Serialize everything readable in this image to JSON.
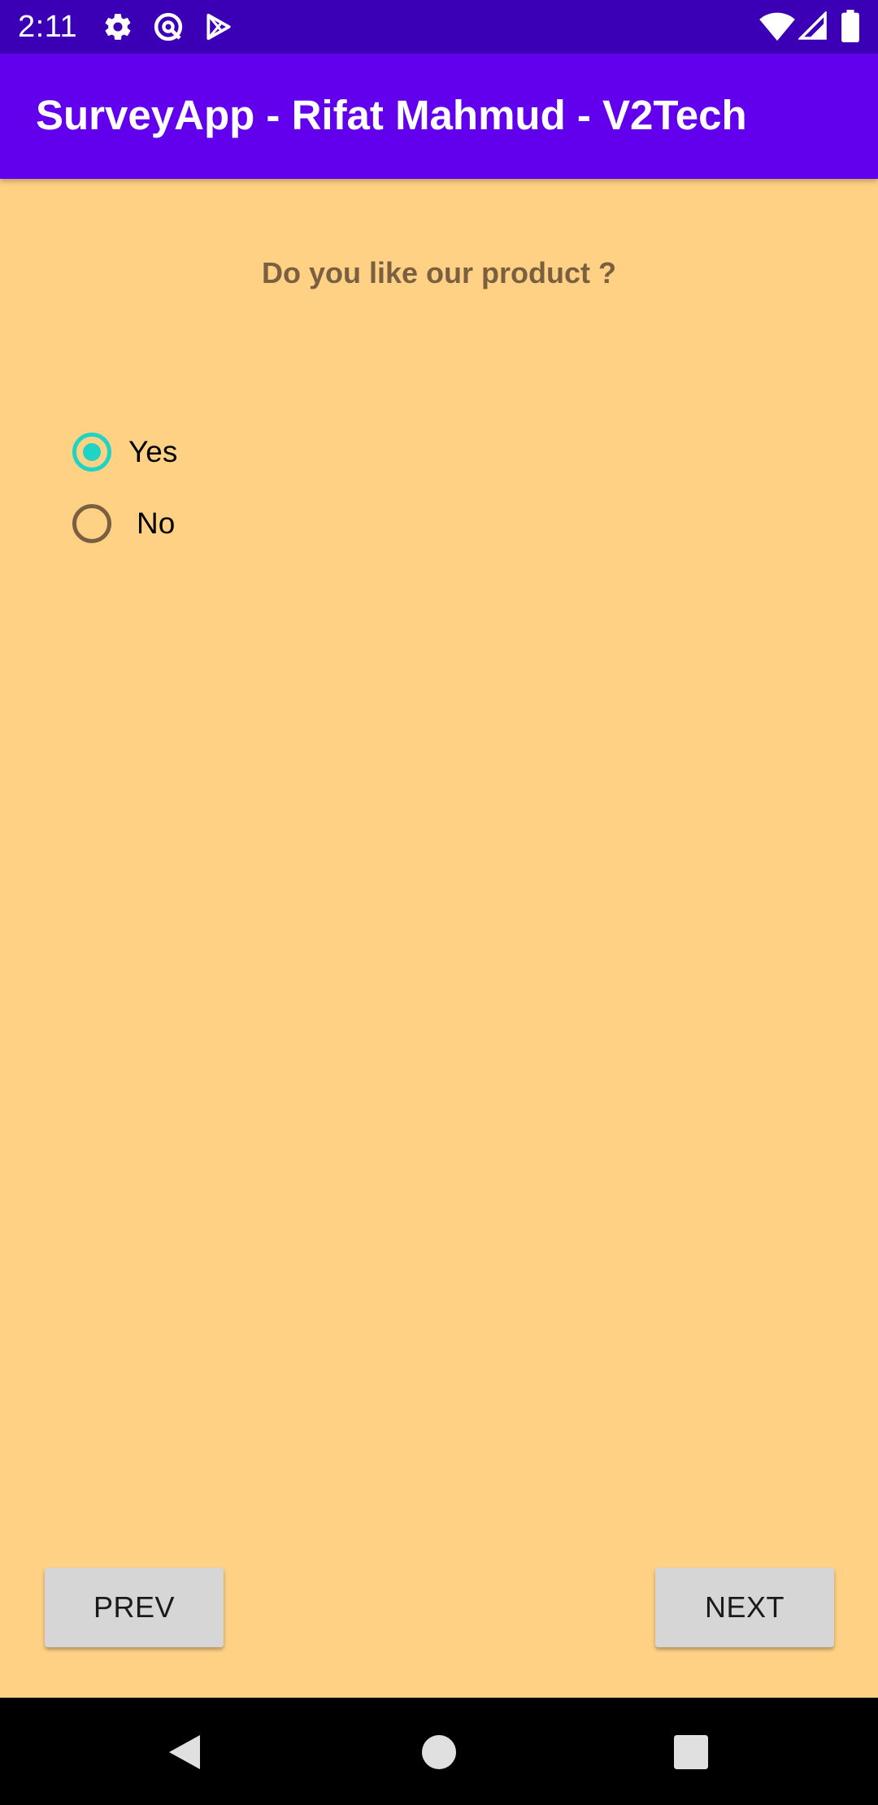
{
  "status_bar": {
    "time": "2:11",
    "left_icons": [
      "gear-icon",
      "data-saver-icon",
      "play-store-icon"
    ],
    "right_icons": [
      "wifi-icon",
      "cell-signal-icon",
      "battery-icon"
    ]
  },
  "app_bar": {
    "title": "SurveyApp - Rifat Mahmud - V2Tech",
    "color": "#6200EE"
  },
  "survey": {
    "question": "Do you like our product ?",
    "options": [
      {
        "label": "Yes",
        "selected": true
      },
      {
        "label": "No",
        "selected": false
      }
    ],
    "accent_color": "#1FD4C4",
    "background_color": "#FFD184"
  },
  "buttons": {
    "prev_label": "PREV",
    "next_label": "NEXT"
  },
  "nav_bar": {
    "icons": [
      "back-icon",
      "home-icon",
      "recents-icon"
    ]
  }
}
